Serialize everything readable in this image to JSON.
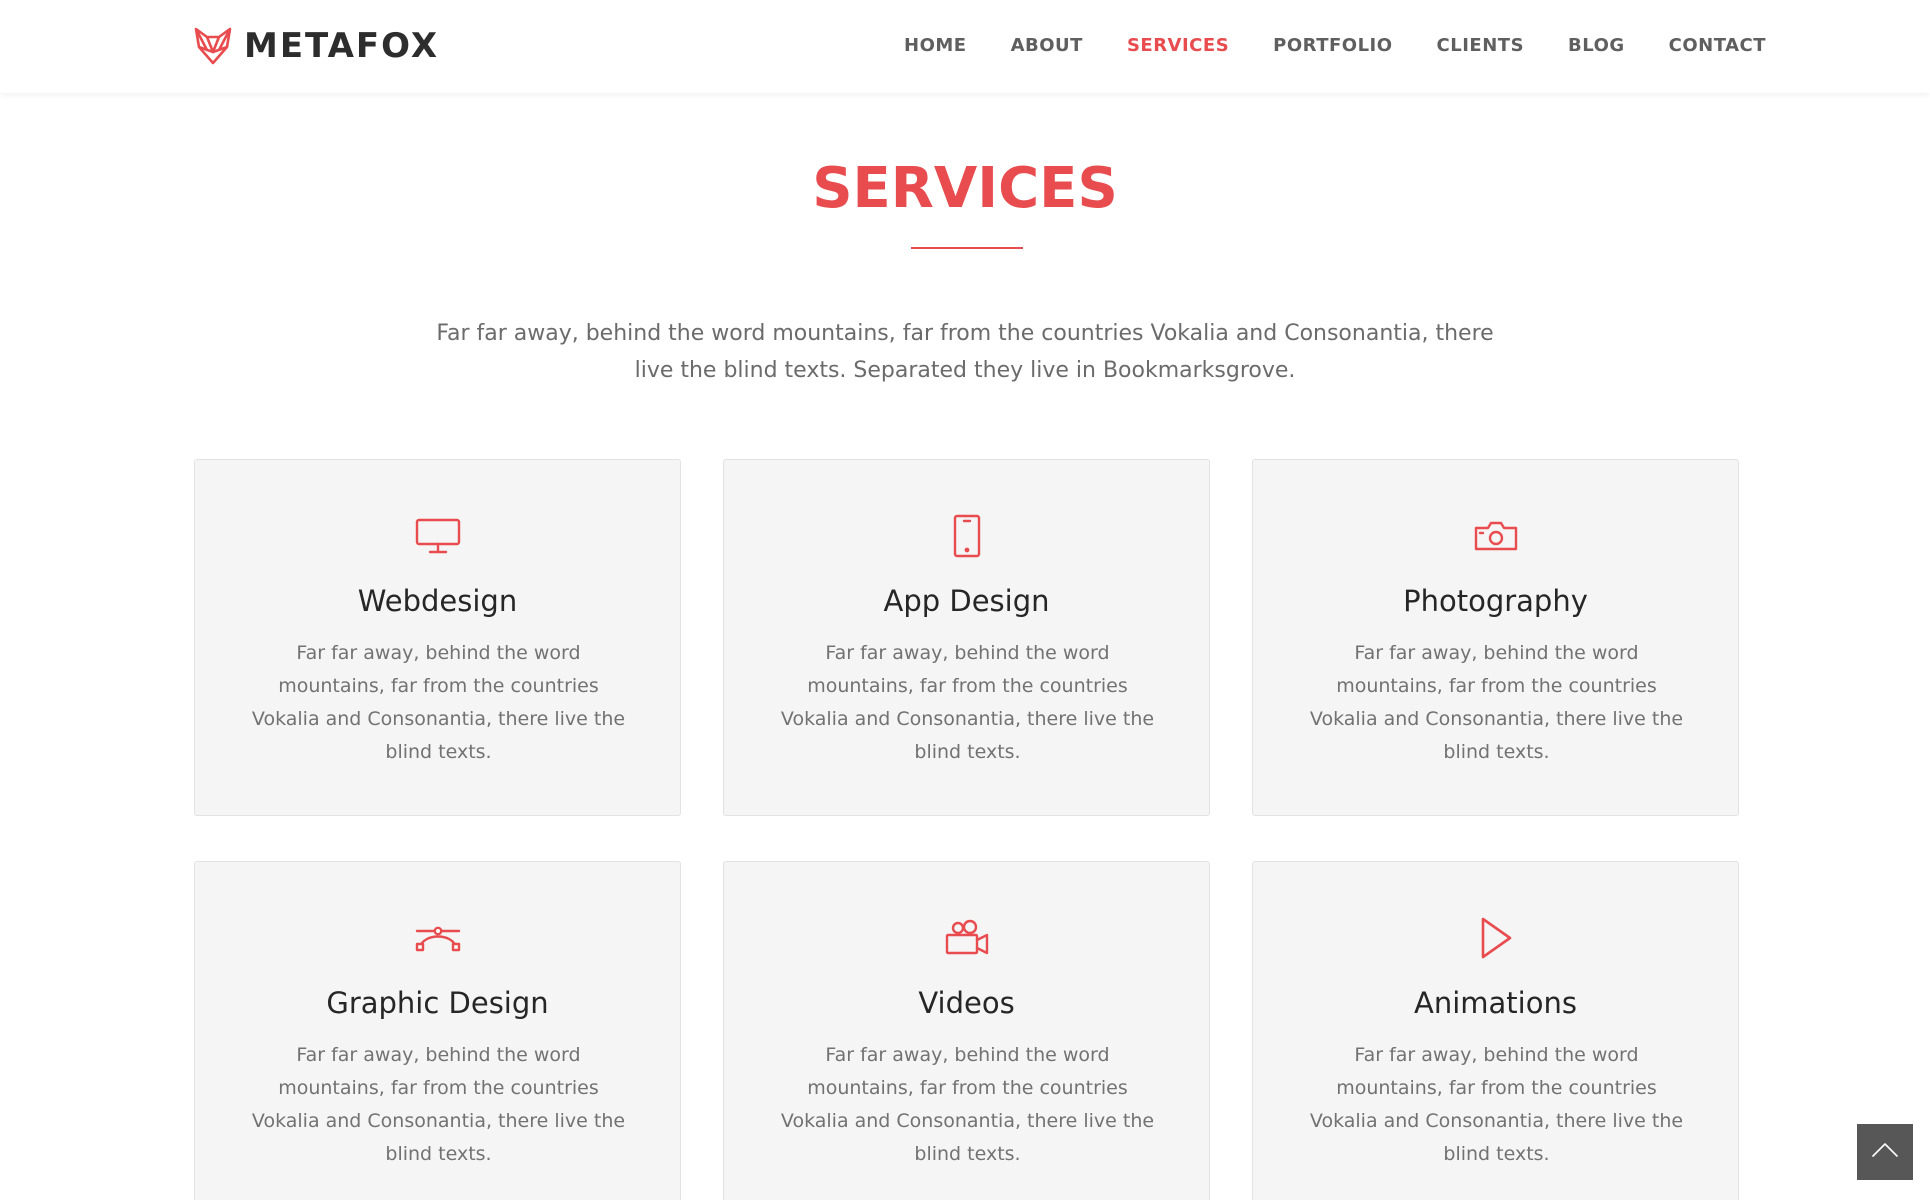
{
  "brand": {
    "name": "METAFOX",
    "logo_icon": "fox-head-icon",
    "accent": "#e84c4f"
  },
  "nav": {
    "items": [
      "HOME",
      "ABOUT",
      "SERVICES",
      "PORTFOLIO",
      "CLIENTS",
      "BLOG",
      "CONTACT"
    ],
    "active": "SERVICES"
  },
  "section": {
    "title": "SERVICES",
    "intro": "Far far away, behind the word mountains, far from the countries Vokalia and Consonantia, there live the blind texts. Separated they live in Bookmarksgrove."
  },
  "services": [
    {
      "title": "Webdesign",
      "icon": "monitor-icon",
      "text": "Far far away, behind the word mountains, far from the countries Vokalia and Consonantia, there live the blind texts."
    },
    {
      "title": "App Design",
      "icon": "smartphone-icon",
      "text": "Far far away, behind the word mountains, far from the countries Vokalia and Consonantia, there live the blind texts."
    },
    {
      "title": "Photography",
      "icon": "camera-icon",
      "text": "Far far away, behind the word mountains, far from the countries Vokalia and Consonantia, there live the blind texts."
    },
    {
      "title": "Graphic Design",
      "icon": "vector-curve-icon",
      "text": "Far far away, behind the word mountains, far from the countries Vokalia and Consonantia, there live the blind texts."
    },
    {
      "title": "Videos",
      "icon": "video-camera-icon",
      "text": "Far far away, behind the word mountains, far from the countries Vokalia and Consonantia, there live the blind texts."
    },
    {
      "title": "Animations",
      "icon": "play-icon",
      "text": "Far far away, behind the word mountains, far from the countries Vokalia and Consonantia, there live the blind texts."
    }
  ],
  "back_to_top": {
    "icon": "chevron-up-icon"
  }
}
